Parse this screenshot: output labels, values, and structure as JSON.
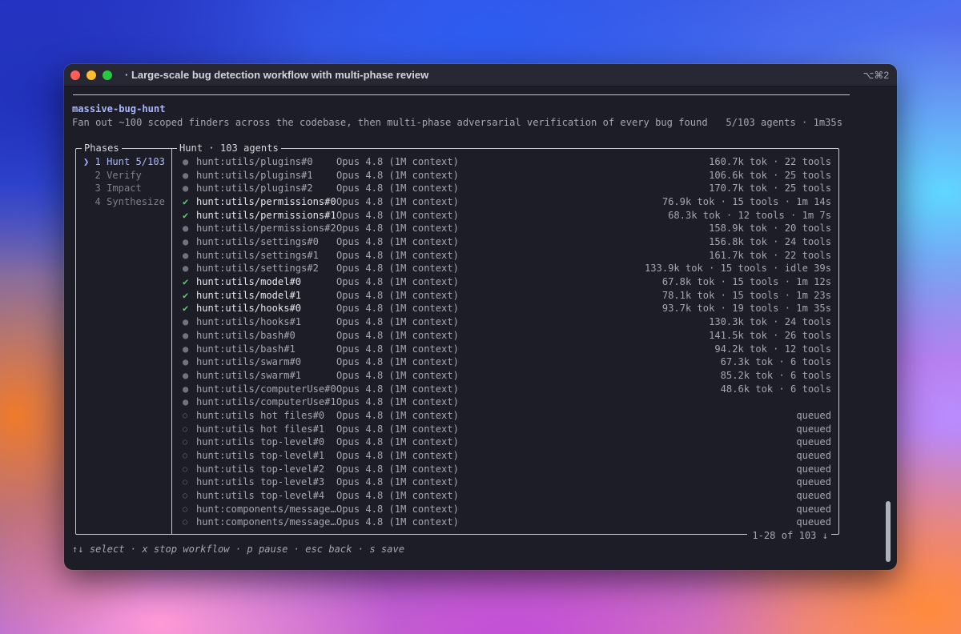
{
  "window": {
    "title": "· Large-scale bug detection workflow with multi-phase review",
    "shortcut": "⌥⌘2"
  },
  "workflow": {
    "name": "massive-bug-hunt",
    "description": "Fan out ~100 scoped finders across the codebase, then multi-phase adversarial verification of every bug found",
    "status": "5/103 agents · 1m35s"
  },
  "phases_panel": {
    "label": "Phases",
    "items": [
      {
        "text": "❯ 1 Hunt 5/103",
        "state": "active"
      },
      {
        "text": "  2 Verify",
        "state": "inactive"
      },
      {
        "text": "  3 Impact",
        "state": "inactive"
      },
      {
        "text": "  4 Synthesize",
        "state": "inactive"
      }
    ]
  },
  "hunt_panel": {
    "label": "Hunt · 103 agents",
    "pager": "1-28 of 103 ↓",
    "rows": [
      {
        "status": "running",
        "symbol": "●",
        "name": "hunt:utils/plugins#0",
        "model": "Opus 4.8 (1M context)",
        "stats": "160.7k tok · 22 tools"
      },
      {
        "status": "running",
        "symbol": "●",
        "name": "hunt:utils/plugins#1",
        "model": "Opus 4.8 (1M context)",
        "stats": "106.6k tok · 25 tools"
      },
      {
        "status": "running",
        "symbol": "●",
        "name": "hunt:utils/plugins#2",
        "model": "Opus 4.8 (1M context)",
        "stats": "170.7k tok · 25 tools"
      },
      {
        "status": "done",
        "symbol": "✔",
        "name": "hunt:utils/permissions#0",
        "model": "Opus 4.8 (1M context)",
        "stats": "76.9k tok · 15 tools · 1m 14s"
      },
      {
        "status": "done",
        "symbol": "✔",
        "name": "hunt:utils/permissions#1",
        "model": "Opus 4.8 (1M context)",
        "stats": "68.3k tok · 12 tools · 1m 7s"
      },
      {
        "status": "running",
        "symbol": "●",
        "name": "hunt:utils/permissions#2",
        "model": "Opus 4.8 (1M context)",
        "stats": "158.9k tok · 20 tools"
      },
      {
        "status": "running",
        "symbol": "●",
        "name": "hunt:utils/settings#0",
        "model": "Opus 4.8 (1M context)",
        "stats": "156.8k tok · 24 tools"
      },
      {
        "status": "running",
        "symbol": "●",
        "name": "hunt:utils/settings#1",
        "model": "Opus 4.8 (1M context)",
        "stats": "161.7k tok · 22 tools"
      },
      {
        "status": "running",
        "symbol": "●",
        "name": "hunt:utils/settings#2",
        "model": "Opus 4.8 (1M context)",
        "stats": "133.9k tok · 15 tools · idle 39s"
      },
      {
        "status": "done",
        "symbol": "✔",
        "name": "hunt:utils/model#0",
        "model": "Opus 4.8 (1M context)",
        "stats": "67.8k tok · 15 tools · 1m 12s"
      },
      {
        "status": "done",
        "symbol": "✔",
        "name": "hunt:utils/model#1",
        "model": "Opus 4.8 (1M context)",
        "stats": "78.1k tok · 15 tools · 1m 23s"
      },
      {
        "status": "done",
        "symbol": "✔",
        "name": "hunt:utils/hooks#0",
        "model": "Opus 4.8 (1M context)",
        "stats": "93.7k tok · 19 tools · 1m 35s"
      },
      {
        "status": "running",
        "symbol": "●",
        "name": "hunt:utils/hooks#1",
        "model": "Opus 4.8 (1M context)",
        "stats": "130.3k tok · 24 tools"
      },
      {
        "status": "running",
        "symbol": "●",
        "name": "hunt:utils/bash#0",
        "model": "Opus 4.8 (1M context)",
        "stats": "141.5k tok · 26 tools"
      },
      {
        "status": "running",
        "symbol": "●",
        "name": "hunt:utils/bash#1",
        "model": "Opus 4.8 (1M context)",
        "stats": "94.2k tok · 12 tools"
      },
      {
        "status": "running",
        "symbol": "●",
        "name": "hunt:utils/swarm#0",
        "model": "Opus 4.8 (1M context)",
        "stats": "67.3k tok · 6 tools"
      },
      {
        "status": "running",
        "symbol": "●",
        "name": "hunt:utils/swarm#1",
        "model": "Opus 4.8 (1M context)",
        "stats": "85.2k tok · 6 tools"
      },
      {
        "status": "running",
        "symbol": "●",
        "name": "hunt:utils/computerUse#0",
        "model": "Opus 4.8 (1M context)",
        "stats": "48.6k tok · 6 tools"
      },
      {
        "status": "running",
        "symbol": "●",
        "name": "hunt:utils/computerUse#1",
        "model": "Opus 4.8 (1M context)",
        "stats": ""
      },
      {
        "status": "queued",
        "symbol": "○",
        "name": "hunt:utils hot files#0",
        "model": "Opus 4.8 (1M context)",
        "stats": "queued"
      },
      {
        "status": "queued",
        "symbol": "○",
        "name": "hunt:utils hot files#1",
        "model": "Opus 4.8 (1M context)",
        "stats": "queued"
      },
      {
        "status": "queued",
        "symbol": "○",
        "name": "hunt:utils top-level#0",
        "model": "Opus 4.8 (1M context)",
        "stats": "queued"
      },
      {
        "status": "queued",
        "symbol": "○",
        "name": "hunt:utils top-level#1",
        "model": "Opus 4.8 (1M context)",
        "stats": "queued"
      },
      {
        "status": "queued",
        "symbol": "○",
        "name": "hunt:utils top-level#2",
        "model": "Opus 4.8 (1M context)",
        "stats": "queued"
      },
      {
        "status": "queued",
        "symbol": "○",
        "name": "hunt:utils top-level#3",
        "model": "Opus 4.8 (1M context)",
        "stats": "queued"
      },
      {
        "status": "queued",
        "symbol": "○",
        "name": "hunt:utils top-level#4",
        "model": "Opus 4.8 (1M context)",
        "stats": "queued"
      },
      {
        "status": "queued",
        "symbol": "○",
        "name": "hunt:components/message…",
        "model": "Opus 4.8 (1M context)",
        "stats": "queued"
      },
      {
        "status": "queued",
        "symbol": "○",
        "name": "hunt:components/message…",
        "model": "Opus 4.8 (1M context)",
        "stats": "queued"
      }
    ]
  },
  "footer": {
    "keys": "↑↓ select · x stop workflow · p pause · esc back · s save"
  },
  "colors": {
    "accent": "#a9b6ff",
    "done": "#56d06a",
    "background": "#1c1d27"
  }
}
